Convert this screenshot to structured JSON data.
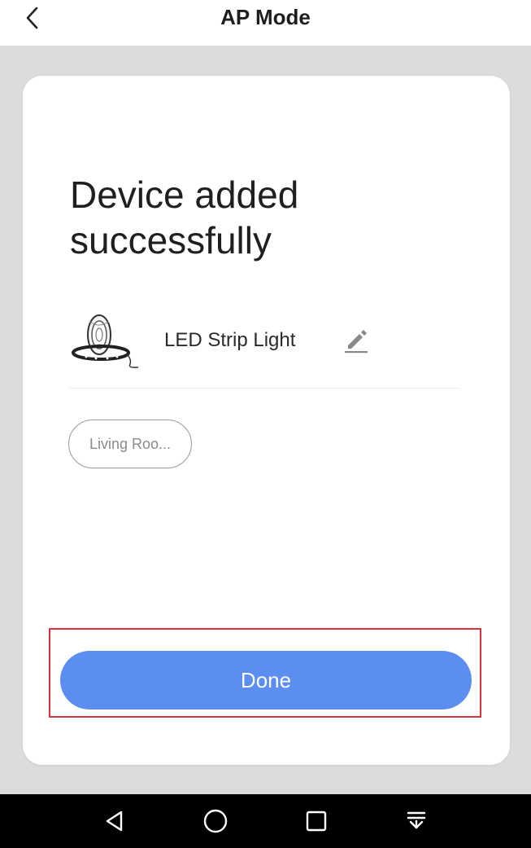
{
  "header": {
    "title": "AP Mode",
    "back_icon": "chevron-left-icon"
  },
  "card": {
    "title": "Device added successfully",
    "device": {
      "name": "LED Strip Light",
      "image_icon": "led-strip-light-icon",
      "edit_icon": "pencil-icon"
    },
    "room_chip": "Living Roo...",
    "done_label": "Done"
  },
  "navbar": {
    "icons": [
      "back-triangle-icon",
      "home-circle-icon",
      "recents-square-icon",
      "notification-pull-icon"
    ]
  },
  "colors": {
    "background": "#dcdcdc",
    "card": "#ffffff",
    "done_button": "#5b8ef0",
    "highlight": "#d9323c",
    "navbar": "#000000"
  }
}
